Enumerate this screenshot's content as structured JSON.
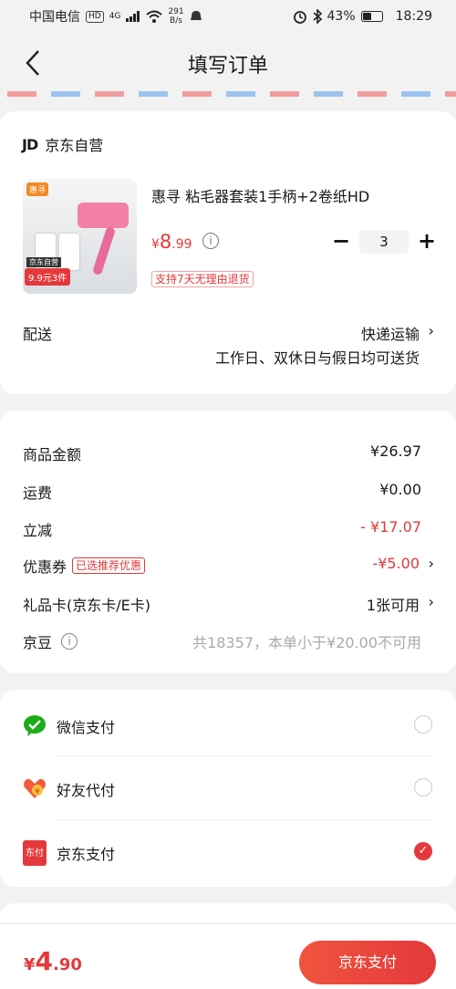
{
  "status": {
    "carrier": "中国电信",
    "hd": "HD",
    "net_type": "4G",
    "speed_value": "291",
    "speed_unit": "B/s",
    "battery": "43%",
    "time": "18:29"
  },
  "nav": {
    "title": "填写订单"
  },
  "shop": {
    "logo": "JD",
    "name": "京东自营"
  },
  "product": {
    "title": "惠寻 粘毛器套装1手柄+2卷纸HD",
    "price_symbol": "¥",
    "price_int": "8",
    "price_dec": ".99",
    "qty": "3",
    "qty_minus": "−",
    "qty_plus": "+",
    "return_tag": "支持7天无理由退货",
    "thumb_brand": "惠寻",
    "thumb_promo": "9.9元3件",
    "thumb_tag": "京东自营"
  },
  "delivery": {
    "label": "配送",
    "method": "快递运输",
    "note": "工作日、双休日与假日均可送货"
  },
  "summary": {
    "goods_label": "商品金额",
    "goods_value": "¥26.97",
    "ship_label": "运费",
    "ship_value": "¥0.00",
    "discount_label": "立减",
    "discount_value": "- ¥17.07",
    "coupon_label": "优惠券",
    "coupon_tag": "已选推荐优惠",
    "coupon_value": "-¥5.00",
    "gift_label": "礼品卡(京东卡/E卡)",
    "gift_value": "1张可用",
    "bean_label": "京豆",
    "bean_value": "共18357，本单小于¥20.00不可用"
  },
  "payment": {
    "options": [
      {
        "label": "微信支付",
        "icon": "wechat-pay-icon"
      },
      {
        "label": "好友代付",
        "icon": "friend-pay-icon"
      },
      {
        "label": "京东支付",
        "icon": "jd-pay-icon",
        "selected": true
      }
    ],
    "jd_icon_text": "东付"
  },
  "footer": {
    "symbol": "¥",
    "amount_int": "4",
    "amount_dec": ".90",
    "button": "京东支付"
  },
  "colors": {
    "accent": "#e4393c",
    "wechat": "#1aad19"
  }
}
